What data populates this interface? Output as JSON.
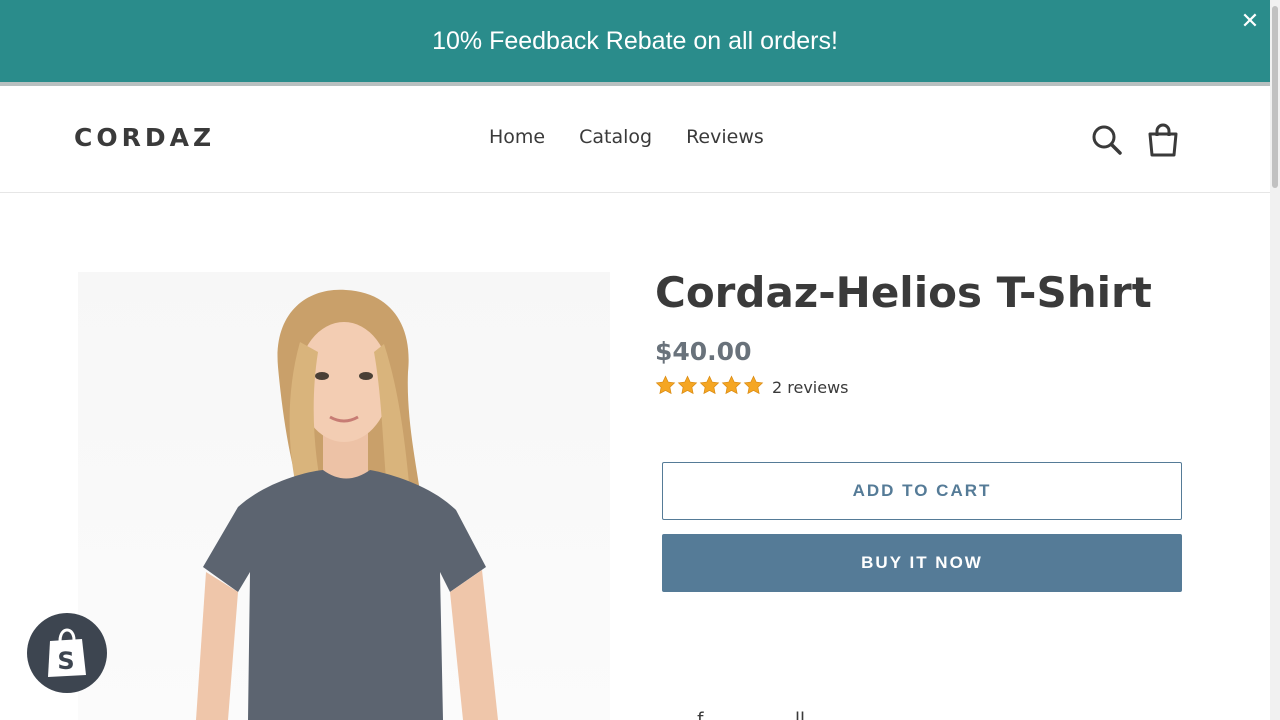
{
  "announcement": {
    "text": "10% Feedback Rebate on all orders!",
    "close_label": "✕"
  },
  "header": {
    "logo": "CORDAZ",
    "nav": [
      {
        "label": "Home"
      },
      {
        "label": "Catalog"
      },
      {
        "label": "Reviews"
      }
    ],
    "icons": {
      "search": "search-icon",
      "cart": "cart-icon"
    }
  },
  "product": {
    "title": "Cordaz-Helios T-Shirt",
    "price": "$40.00",
    "rating": {
      "stars": 5,
      "max": 5,
      "reviews_label": "2 reviews"
    },
    "add_to_cart_label": "ADD TO CART",
    "buy_now_label": "BUY IT NOW",
    "description_fragment": "...f  ...  ...  ...  ...ll..."
  },
  "colors": {
    "announcement_bg": "#2a8c8b",
    "button_accent": "#557b97",
    "star": "#f5a623"
  }
}
